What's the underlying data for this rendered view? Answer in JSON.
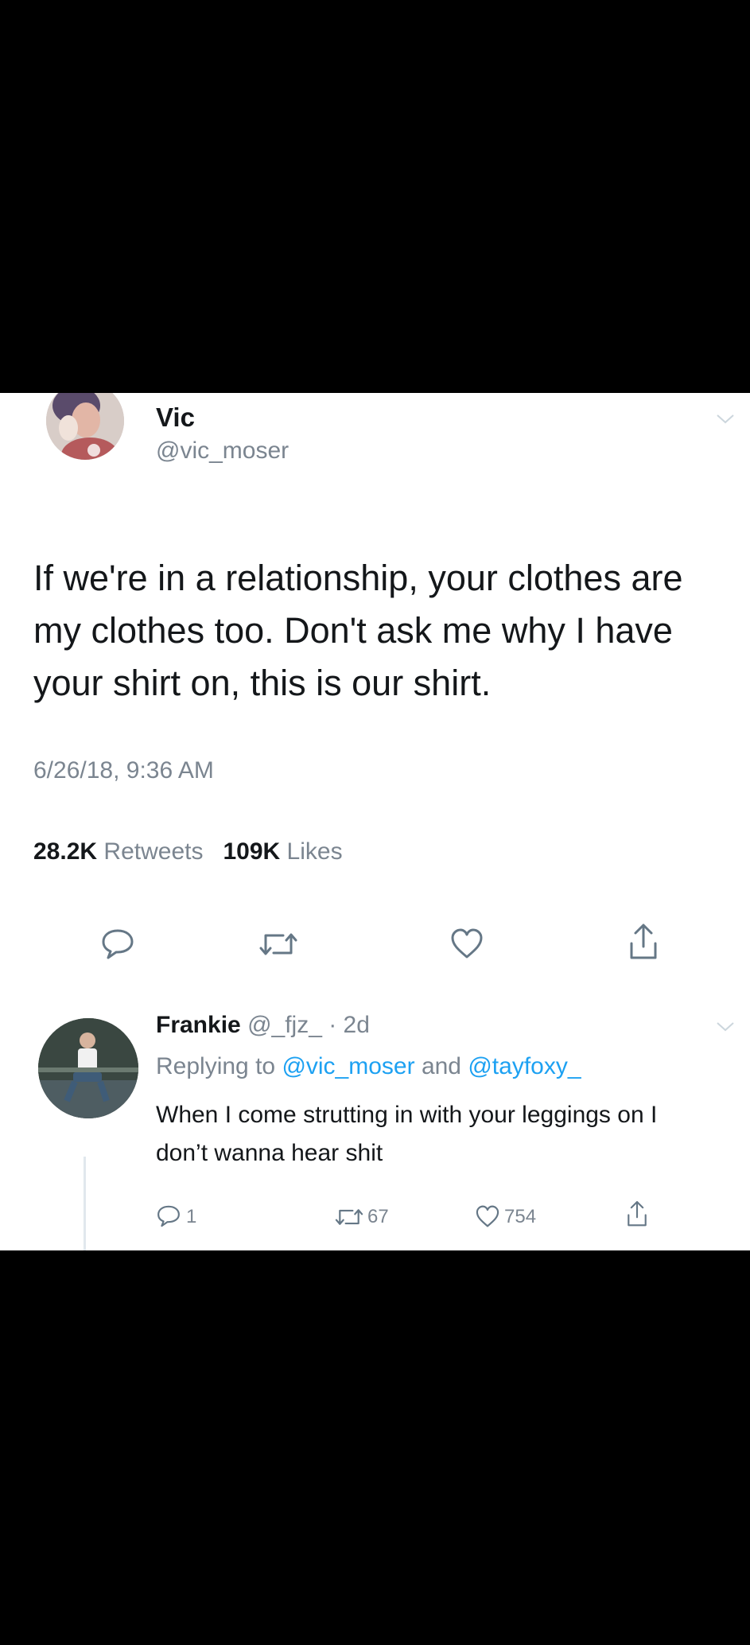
{
  "tweet": {
    "name": "Vic",
    "handle": "@vic_moser",
    "text": "If we're in a relationship, your clothes are my clothes too. Don't ask me why I have your shirt on, this is our shirt.",
    "timestamp": "6/26/18, 9:36 AM",
    "retweets_count": "28.2K",
    "retweets_label": "Retweets",
    "likes_count": "109K",
    "likes_label": "Likes"
  },
  "reply": {
    "name": "Frankie",
    "handle": "@_fjz_",
    "age": "· 2d",
    "replying_prefix": "Replying to",
    "replying_user1": "@vic_moser",
    "replying_and": "and",
    "replying_user2": "@tayfoxy_",
    "text": "When I come strutting in with your leggings on I don’t wanna hear shit",
    "reply_count": "1",
    "retweet_count": "67",
    "like_count": "754"
  },
  "icons": [
    "comment-icon",
    "retweet-icon",
    "heart-icon",
    "share-icon",
    "chevron-down-icon"
  ],
  "colors": {
    "text": "#14171a",
    "secondary": "#7b8590",
    "link": "#1da1f2",
    "background": "#ffffff",
    "frame": "#000000"
  }
}
